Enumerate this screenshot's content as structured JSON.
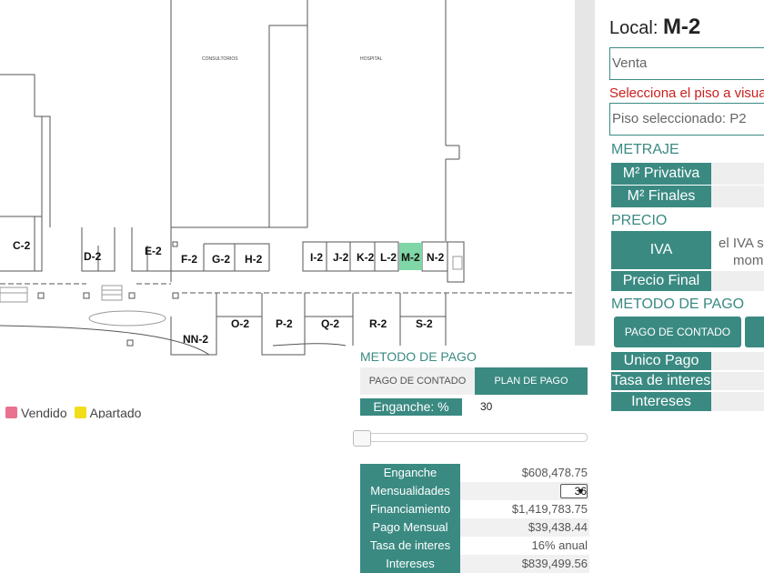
{
  "floorplan": {
    "building_labels": {
      "consultorios": "CONSULTORIOS",
      "hospital": "HOSPITAL"
    },
    "units": [
      "C-2",
      "D-2",
      "E-2",
      "F-2",
      "G-2",
      "H-2",
      "I-2",
      "J-2",
      "K-2",
      "L-2",
      "M-2",
      "N-2",
      "NN-2",
      "O-2",
      "P-2",
      "Q-2",
      "R-2",
      "S-2"
    ],
    "selected_unit": "M-2",
    "legend": [
      {
        "label": "Vendido",
        "color": "#e8728f"
      },
      {
        "label": "Apartado",
        "color": "#f2dd1a"
      }
    ]
  },
  "panel": {
    "local_label": "Local:",
    "local_code": "M-2",
    "operation": "Venta",
    "floor_warning": "Selecciona el piso a visual",
    "floor_selected": "Piso seleccionado: P2",
    "metraje_title": "METRAJE",
    "m2_privativa": "M² Privativa",
    "m2_finales": "M² Finales",
    "precio_title": "PRECIO",
    "iva_label": "IVA",
    "iva_note_1": "el IVA s",
    "iva_note_2": "mom",
    "precio_final": "Precio Final",
    "metodo_title": "METODO DE PAGO",
    "pago_contado_btn": "PAGO DE CONTADO",
    "unico_pago": "Unico Pago",
    "tasa_interes": "Tasa de interes",
    "intereses": "Intereses"
  },
  "payment": {
    "title": "METODO DE PAGO",
    "tab_contado": "PAGO DE CONTADO",
    "tab_plan": "PLAN DE PAGO",
    "enganche_label": "Enganche: %",
    "enganche_pct": "30",
    "slider_fraction": 0.0,
    "rows": {
      "enganche": {
        "label": "Enganche",
        "value": "$608,478.75"
      },
      "mensualidades": {
        "label": "Mensualidades",
        "value": "36"
      },
      "financiamiento": {
        "label": "Financiamiento",
        "value": "$1,419,783.75"
      },
      "pago_mensual": {
        "label": "Pago Mensual",
        "value": "$39,438.44"
      },
      "tasa": {
        "label": "Tasa de interes",
        "value": "16% anual"
      },
      "intereses": {
        "label": "Intereses",
        "value": "$839,499.56"
      }
    }
  },
  "colors": {
    "accent": "#3a8a82",
    "selected_unit": "#7fd6a6",
    "warning": "#cc1d1d"
  }
}
